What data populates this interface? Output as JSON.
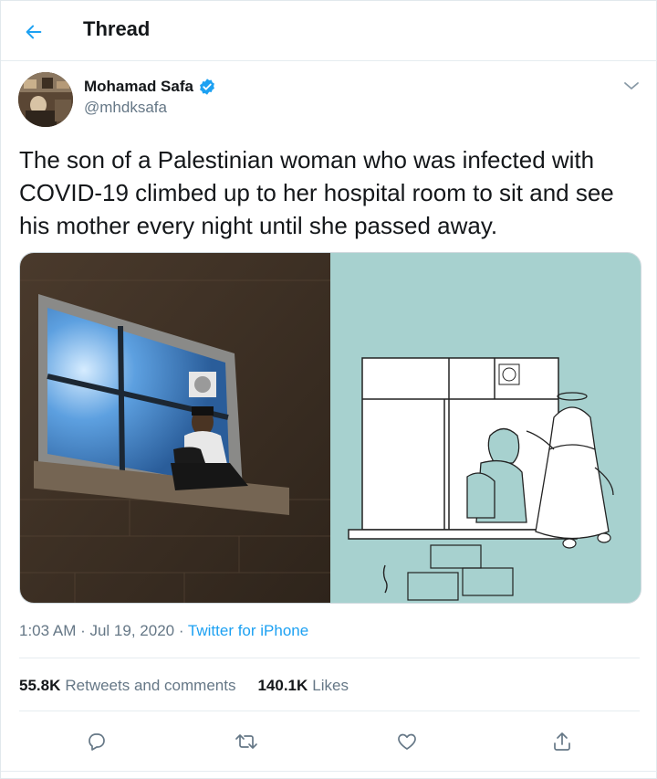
{
  "header": {
    "title": "Thread",
    "back_icon": "arrow-left-icon"
  },
  "author": {
    "name": "Mohamad Safa",
    "handle": "@mhdksafa",
    "verified_icon": "verified-badge-icon",
    "menu_icon": "chevron-down-icon"
  },
  "tweet": {
    "text": "The son of a Palestinian woman who was infected with COVID-19 climbed up to her hospital room to sit and see his mother every night until she passed away.",
    "time": "1:03 AM · Jul 19, 2020 · ",
    "source": "Twitter for iPhone"
  },
  "stats": {
    "retweets_count": "55.8K",
    "retweets_label": "Retweets and comments",
    "likes_count": "140.1K",
    "likes_label": "Likes"
  },
  "actions": [
    "reply-icon",
    "retweet-icon",
    "like-icon",
    "share-icon"
  ],
  "colors": {
    "accent": "#1da1f2",
    "muted": "#657786",
    "text": "#14171a",
    "border": "#e6ecf0",
    "cartoon_bg": "#a7d1cf"
  }
}
